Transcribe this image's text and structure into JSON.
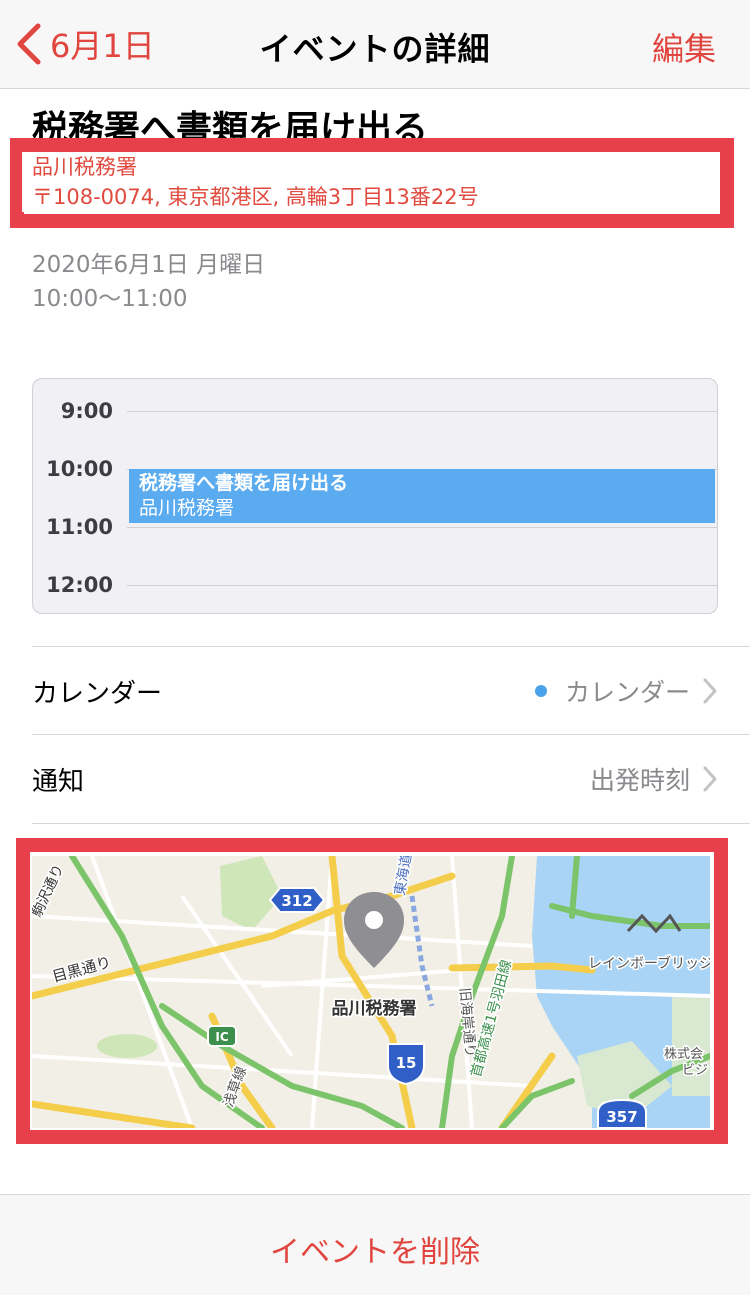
{
  "navbar": {
    "back_label": "6月1日",
    "title": "イベントの詳細",
    "edit_label": "編集"
  },
  "event": {
    "title": "税務署へ書類を届け出る",
    "location_name": "品川税務署",
    "location_address": "〒108-0074, 東京都港区, 高輪3丁目13番22号",
    "date": "2020年6月1日 月曜日",
    "time": "10:00〜11:00"
  },
  "day_view": {
    "hours": [
      "9:00",
      "10:00",
      "11:00",
      "12:00"
    ],
    "event_title": "税務署へ書類を届け出る",
    "event_location": "品川税務署"
  },
  "rows": {
    "calendar_label": "カレンダー",
    "calendar_value": "カレンダー",
    "alert_label": "通知",
    "alert_value": "出発時刻"
  },
  "map": {
    "pin_label": "品川税務署",
    "road_312": "312",
    "road_15": "15",
    "road_357": "357",
    "ic_label": "IC",
    "meguro": "目黒通り",
    "komazawa": "駒沢通り",
    "tokaido": "東海道本",
    "kyukaigan": "旧海岸通り",
    "expressway": "首都高速1号羽田線",
    "asakusa": "浅草線",
    "rainbow": "レインボーブリッジ",
    "company": "株式会",
    "bldg": "ビジ"
  },
  "bottom": {
    "delete_label": "イベントを削除"
  },
  "colors": {
    "accent": "#e0463f",
    "highlight": "#e8404a",
    "event_block": "#5aabf0"
  }
}
